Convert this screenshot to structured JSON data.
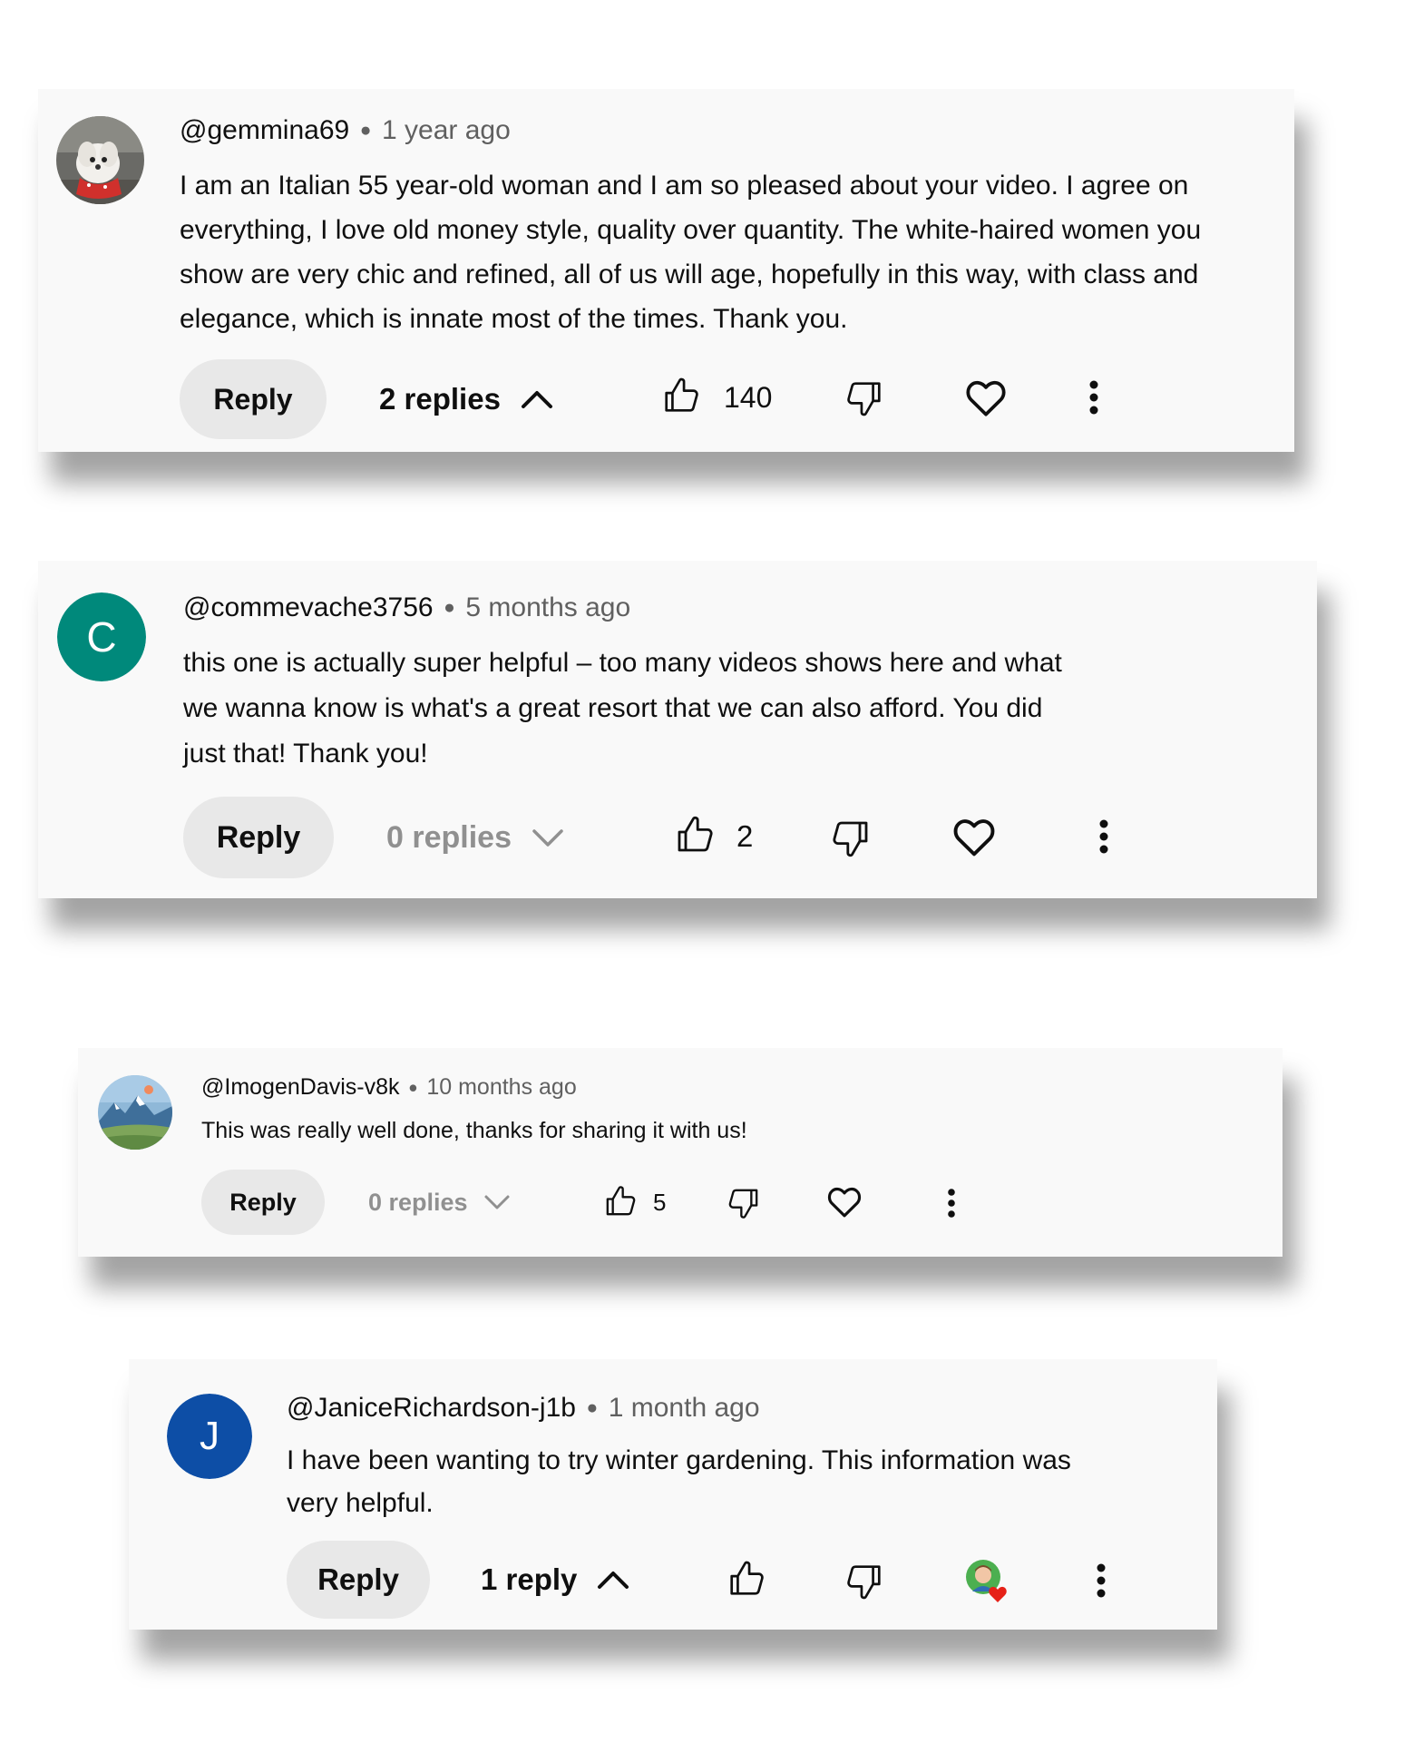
{
  "comments": [
    {
      "handle": "@gemmina69",
      "time": "1 year ago",
      "text": "I am an Italian 55 year-old woman and I am so pleased about your video. I agree on everything, I love old money style, quality over quantity. The white-haired women you show are very chic and refined, all of us will age, hopefully in this way, with class and elegance, which is innate most of the times. Thank you.",
      "reply_label": "Reply",
      "replies_label": "2 replies",
      "likes": "140",
      "avatar_icon": "dog-photo-icon"
    },
    {
      "handle": "@commevache3756",
      "time": "5 months ago",
      "text_lines": [
        "this one is actually super helpful – too many videos shows here and what",
        "we wanna know is what's a great resort that we can also afford.  You did",
        "just that! Thank you!"
      ],
      "reply_label": "Reply",
      "replies_label": "0 replies",
      "likes": "2",
      "avatar_letter": "C",
      "avatar_color": "#00897b"
    },
    {
      "handle": "@ImogenDavis-v8k",
      "time": "10 months ago",
      "text": "This was really well done, thanks for sharing it with us!",
      "reply_label": "Reply",
      "replies_label": "0 replies",
      "likes": "5",
      "avatar_icon": "mountain-landscape-icon"
    },
    {
      "handle": "@JaniceRichardson-j1b",
      "time": "1 month ago",
      "text_lines": [
        "I have been wanting to try winter gardening.  This information was",
        "very helpful."
      ],
      "reply_label": "Reply",
      "replies_label": "1 reply",
      "avatar_letter": "J",
      "avatar_color": "#0d4ea6"
    }
  ],
  "colors": {
    "card_bg": "#f9f9f9",
    "reply_button_bg": "#e8e8e8",
    "secondary_text": "#606060",
    "muted_text": "#909090",
    "heart_red": "#e62117"
  }
}
